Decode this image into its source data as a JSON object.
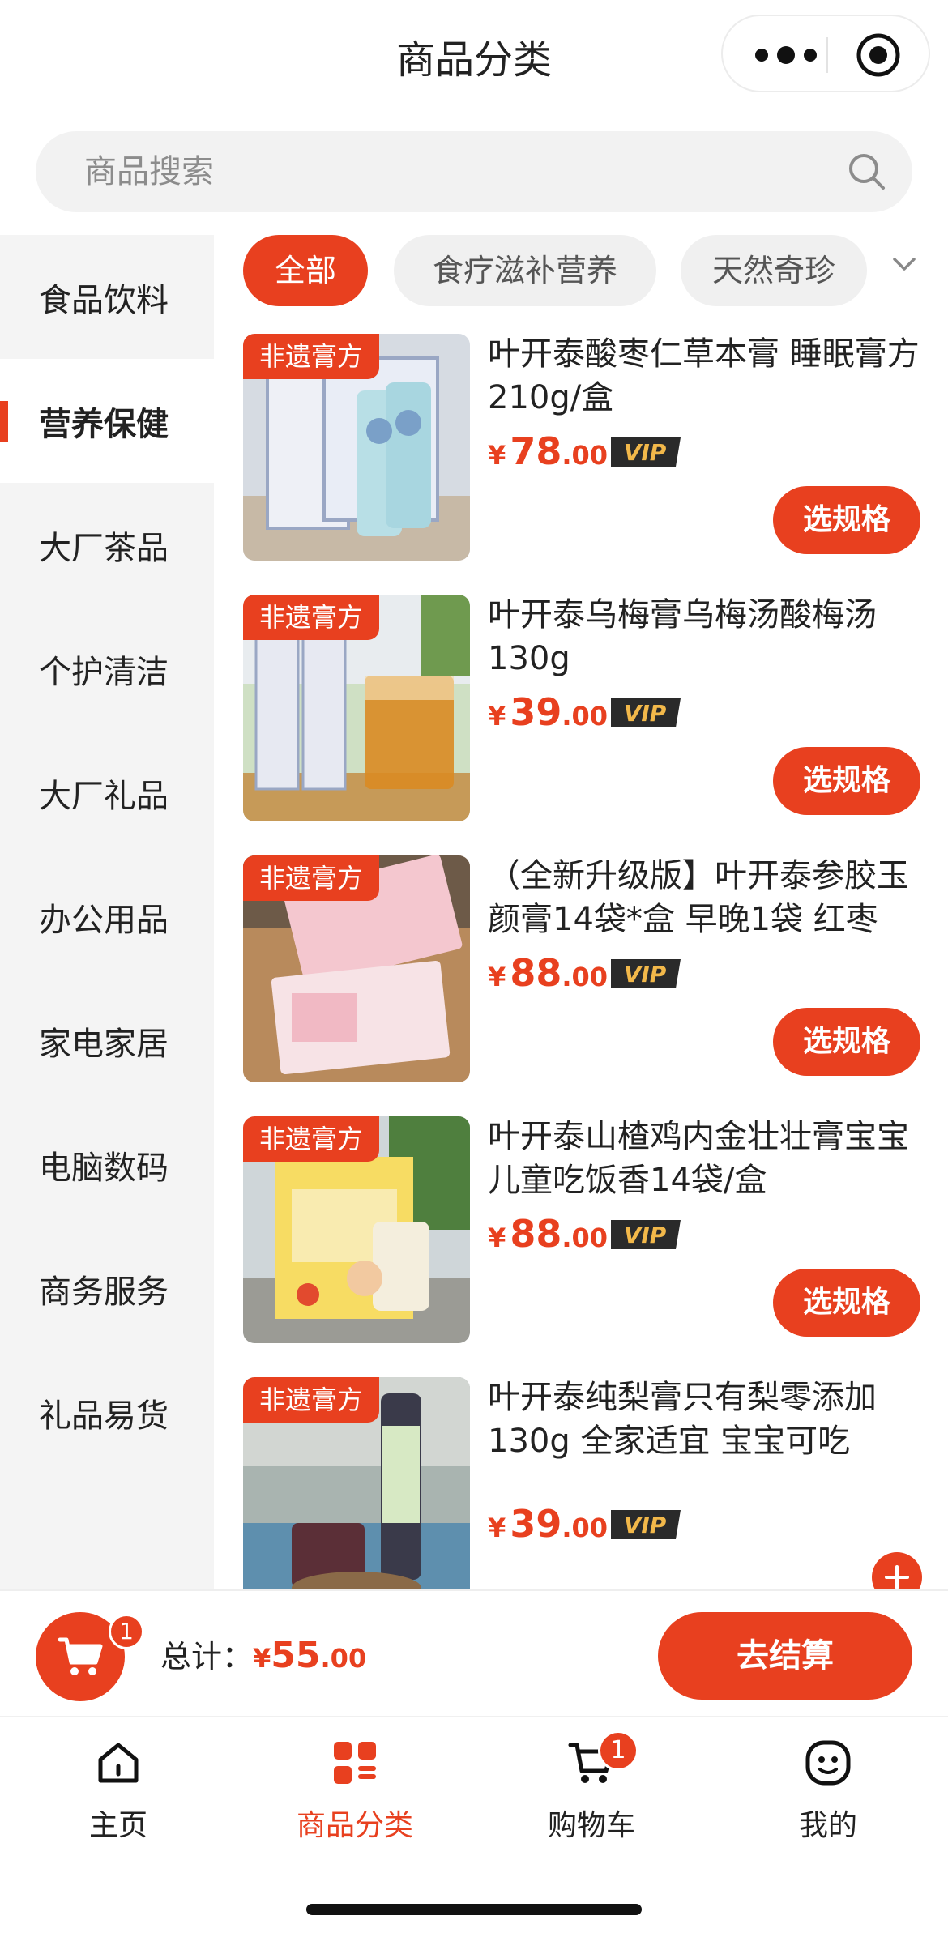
{
  "header": {
    "title": "商品分类"
  },
  "search": {
    "placeholder": "商品搜索"
  },
  "sidebar": {
    "items": [
      {
        "label": "食品饮料",
        "active": false
      },
      {
        "label": "营养保健",
        "active": true
      },
      {
        "label": "大厂茶品",
        "active": false
      },
      {
        "label": "个护清洁",
        "active": false
      },
      {
        "label": "大厂礼品",
        "active": false
      },
      {
        "label": "办公用品",
        "active": false
      },
      {
        "label": "家电家居",
        "active": false
      },
      {
        "label": "电脑数码",
        "active": false
      },
      {
        "label": "商务服务",
        "active": false
      },
      {
        "label": "礼品易货",
        "active": false
      }
    ]
  },
  "chips": [
    {
      "label": "全部",
      "active": true
    },
    {
      "label": "食疗滋补营养",
      "active": false
    },
    {
      "label": "天然奇珍",
      "active": false
    }
  ],
  "products": [
    {
      "tag": "非遗膏方",
      "title": "叶开泰酸枣仁草本膏 睡眠膏方 210g/盒",
      "currency": "¥",
      "price_int": "78",
      "price_dec": ".00",
      "vip": "VIP",
      "action": "选规格"
    },
    {
      "tag": "非遗膏方",
      "title": "叶开泰乌梅膏乌梅汤酸梅汤130g",
      "currency": "¥",
      "price_int": "39",
      "price_dec": ".00",
      "vip": "VIP",
      "action": "选规格"
    },
    {
      "tag": "非遗膏方",
      "title": "（全新升级版】叶开泰参胶玉颜膏14袋*盒 早晚1袋 红枣",
      "currency": "¥",
      "price_int": "88",
      "price_dec": ".00",
      "vip": "VIP",
      "action": "选规格"
    },
    {
      "tag": "非遗膏方",
      "title": "叶开泰山楂鸡内金壮壮膏宝宝儿童吃饭香14袋/盒",
      "currency": "¥",
      "price_int": "88",
      "price_dec": ".00",
      "vip": "VIP",
      "action": "选规格"
    },
    {
      "tag": "非遗膏方",
      "title": "叶开泰纯梨膏只有梨零添加130g 全家适宜 宝宝可吃",
      "currency": "¥",
      "price_int": "39",
      "price_dec": ".00",
      "vip": "VIP",
      "action": ""
    }
  ],
  "cart": {
    "count": "1",
    "total_label": "总计：",
    "currency": "¥",
    "total_int": "55",
    "total_dec": ".00",
    "checkout_label": "去结算"
  },
  "tabbar": {
    "items": [
      {
        "label": "主页",
        "icon": "home-icon",
        "active": false
      },
      {
        "label": "商品分类",
        "icon": "category-icon",
        "active": true
      },
      {
        "label": "购物车",
        "icon": "cart-icon",
        "active": false,
        "badge": "1"
      },
      {
        "label": "我的",
        "icon": "profile-icon",
        "active": false
      }
    ]
  },
  "colors": {
    "accent": "#e8401f",
    "sidebar_bg": "#f4f4f4",
    "chip_bg": "#f0f0f0"
  }
}
